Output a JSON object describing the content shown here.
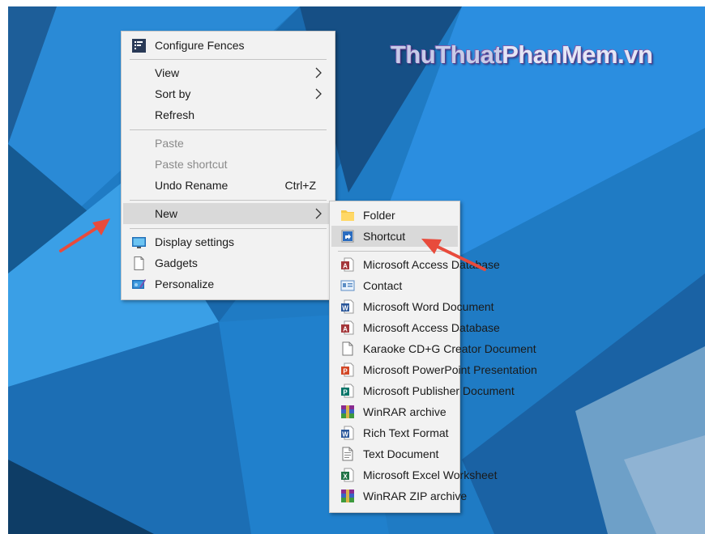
{
  "watermark": {
    "part1": "ThuThuat",
    "part2": "PhanMem.vn"
  },
  "context_menu": {
    "configure_fences": "Configure Fences",
    "view": "View",
    "sort_by": "Sort by",
    "refresh": "Refresh",
    "paste": "Paste",
    "paste_shortcut": "Paste shortcut",
    "undo_rename": "Undo Rename",
    "undo_shortcut": "Ctrl+Z",
    "new": "New",
    "display_settings": "Display settings",
    "gadgets": "Gadgets",
    "personalize": "Personalize"
  },
  "new_submenu": {
    "items": [
      {
        "label": "Folder",
        "icon": "folder-icon"
      },
      {
        "label": "Shortcut",
        "icon": "shortcut-icon"
      },
      {
        "label": "Microsoft Access Database",
        "icon": "access-icon"
      },
      {
        "label": "Contact",
        "icon": "contact-icon"
      },
      {
        "label": "Microsoft Word Document",
        "icon": "word-icon"
      },
      {
        "label": "Microsoft Access Database",
        "icon": "access-icon"
      },
      {
        "label": "Karaoke CD+G Creator Document",
        "icon": "blank-document-icon"
      },
      {
        "label": "Microsoft PowerPoint Presentation",
        "icon": "powerpoint-icon"
      },
      {
        "label": "Microsoft Publisher Document",
        "icon": "publisher-icon"
      },
      {
        "label": "WinRAR archive",
        "icon": "winrar-icon"
      },
      {
        "label": "Rich Text Format",
        "icon": "rtf-icon"
      },
      {
        "label": "Text Document",
        "icon": "text-document-icon"
      },
      {
        "label": "Microsoft Excel Worksheet",
        "icon": "excel-icon"
      },
      {
        "label": "WinRAR ZIP archive",
        "icon": "winrar-zip-icon"
      }
    ]
  },
  "colors": {
    "menu_bg": "#f2f2f2",
    "highlight": "#d9d9d9",
    "arrow": "#e84b3c",
    "desktop": "#1b6fb6"
  }
}
